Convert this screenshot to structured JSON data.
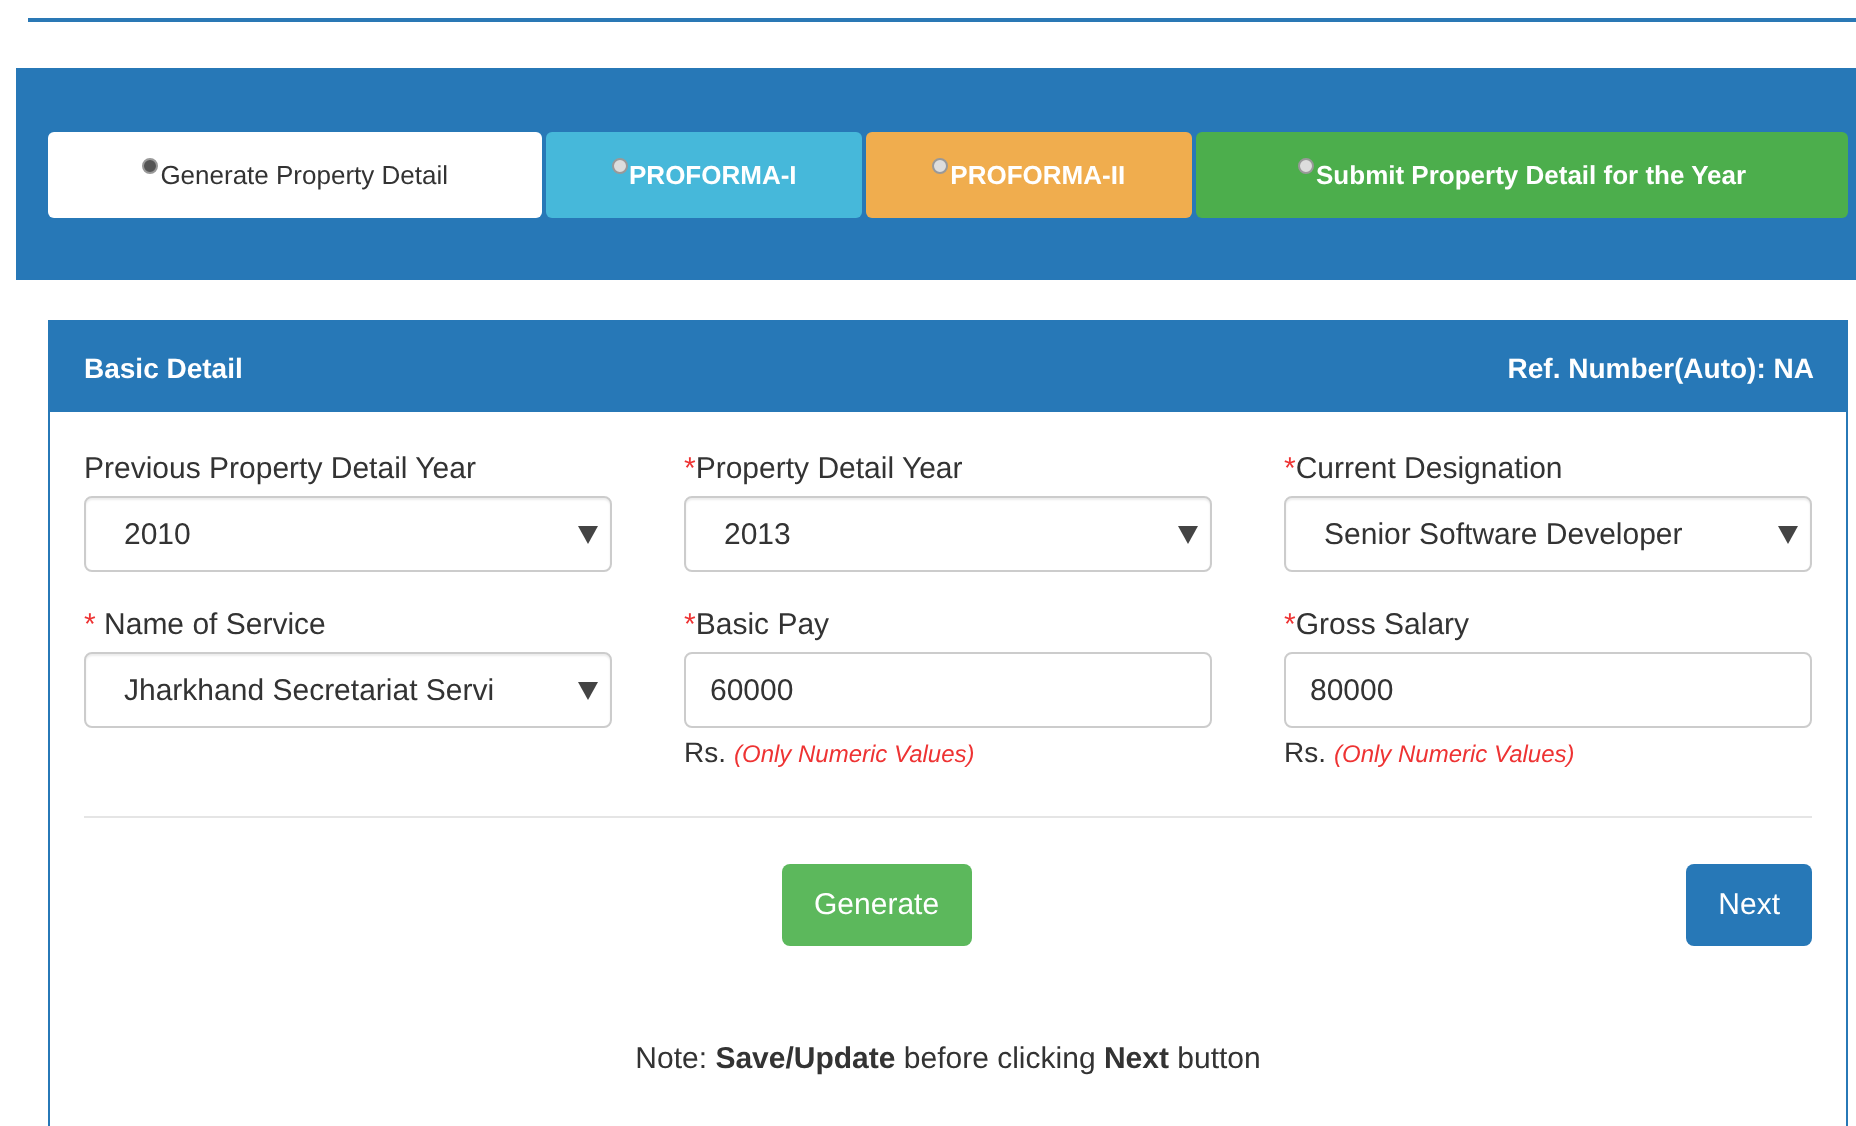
{
  "tabs": [
    {
      "label": "Generate Property Detail",
      "selected": true,
      "color": "#ffffff"
    },
    {
      "label": "PROFORMA-I",
      "selected": false,
      "color": "#46b8da"
    },
    {
      "label": "PROFORMA-II",
      "selected": false,
      "color": "#f0ad4e"
    },
    {
      "label": "Submit Property Detail for the Year",
      "selected": false,
      "color": "#4cae4c"
    }
  ],
  "panel": {
    "title": "Basic Detail",
    "ref_number": "Ref. Number(Auto): NA",
    "fields": [
      {
        "kind": "select",
        "label": "Previous Property Detail Year",
        "value": "2010"
      },
      {
        "kind": "select",
        "label": "Property Detail Year",
        "mark": "*",
        "value": "2013"
      },
      {
        "kind": "select",
        "label": "Current Designation",
        "mark": "*",
        "value": "Senior Software Developer"
      },
      {
        "kind": "select",
        "label": "Name of Service",
        "mark": "* ",
        "value": "Jharkhand Secretariat Servi"
      },
      {
        "kind": "input",
        "label": "Basic Pay",
        "mark": "*",
        "value": "60000",
        "unit": "Rs.",
        "hint": "(Only Numeric Values)"
      },
      {
        "kind": "input",
        "label": "Gross Salary",
        "mark": "*",
        "value": "80000",
        "unit": "Rs.",
        "hint": "(Only Numeric Values)"
      }
    ],
    "buttons": [
      {
        "label": "Generate",
        "kind": "success"
      },
      {
        "label": "Next",
        "kind": "primary"
      }
    ],
    "note": "Note: **Save/Update** before clicking **Next** button"
  }
}
